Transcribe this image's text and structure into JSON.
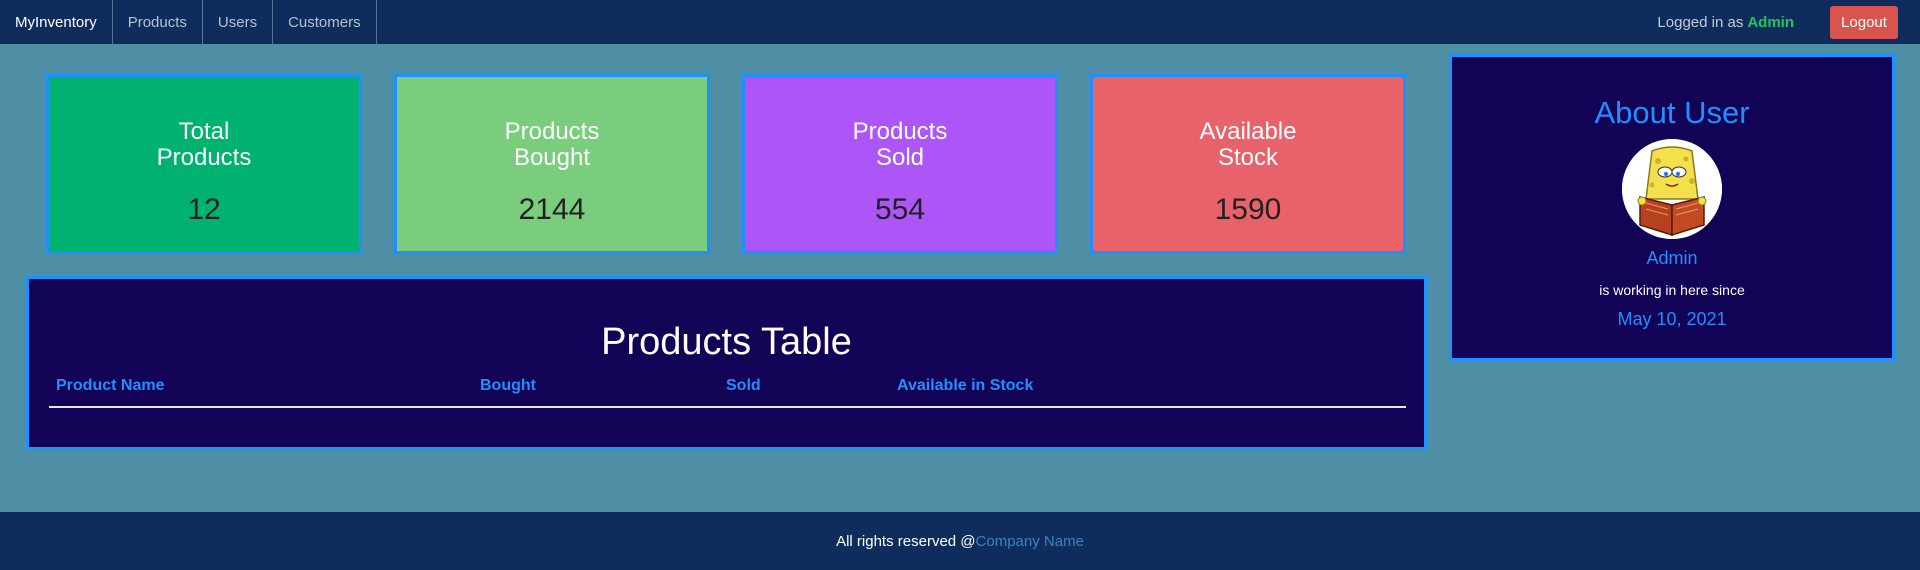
{
  "navbar": {
    "brand": "MyInventory",
    "links": [
      "Products",
      "Users",
      "Customers"
    ],
    "logged_prefix": "Logged in as",
    "username": "Admin",
    "logout_label": "Logout"
  },
  "cards": [
    {
      "title": "Total Products",
      "value": "12",
      "color": "#00b26f"
    },
    {
      "title": "Products Bought",
      "value": "2144",
      "color": "#7acd7d"
    },
    {
      "title": "Products Sold",
      "value": "554",
      "color": "#ad56f7"
    },
    {
      "title": "Available Stock",
      "value": "1590",
      "color": "#e8626b"
    }
  ],
  "table": {
    "title": "Products Table",
    "columns": [
      "Product Name",
      "Bought",
      "Sold",
      "Available in Stock"
    ],
    "rows": []
  },
  "about": {
    "title": "About User",
    "avatar_icon": "spongebob-reading-avatar",
    "name": "Admin",
    "since_text": "is working in here since",
    "date": "May 10, 2021"
  },
  "footer": {
    "text": "All rights reserved @",
    "company": "Company Name"
  },
  "colors": {
    "background": "#4e8fa5",
    "navbar": "#0e2d5c",
    "panel": "#120357",
    "accent": "#1e90ff",
    "logout": "#d9534f",
    "username": "#22c55e"
  }
}
